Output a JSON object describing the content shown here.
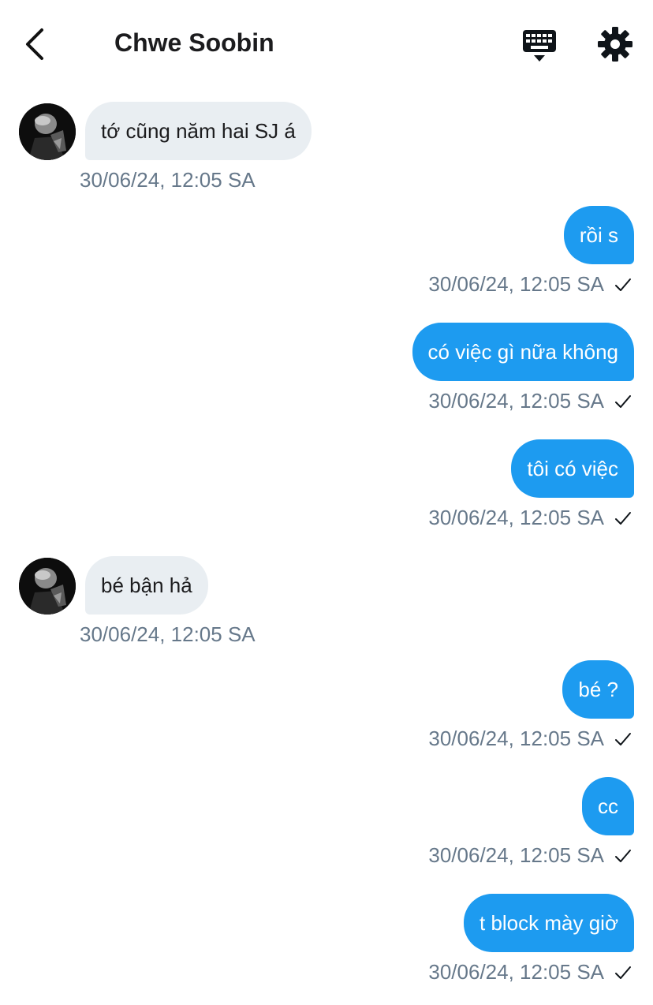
{
  "header": {
    "title": "Chwe Soobin",
    "back_icon": "chevron-left-icon",
    "keyboard_icon": "keyboard-icon",
    "settings_icon": "gear-icon"
  },
  "colors": {
    "outgoing_bubble": "#1d9bf0",
    "incoming_bubble": "#e9eef2",
    "timestamp": "#66788a"
  },
  "messages": [
    {
      "direction": "in",
      "text": "tớ cũng năm hai SJ á",
      "time": "30/06/24, 12:05 SA"
    },
    {
      "direction": "out",
      "text": "rồi s",
      "time": "30/06/24, 12:05 SA",
      "status": "sent-check-icon"
    },
    {
      "direction": "out",
      "text": "có việc gì nữa không",
      "time": "30/06/24, 12:05 SA",
      "status": "sent-check-icon"
    },
    {
      "direction": "out",
      "text": "tôi có việc",
      "time": "30/06/24, 12:05 SA",
      "status": "sent-check-icon"
    },
    {
      "direction": "in",
      "text": "bé bận hả",
      "time": "30/06/24, 12:05 SA"
    },
    {
      "direction": "out",
      "text": "bé ?",
      "time": "30/06/24, 12:05 SA",
      "status": "sent-check-icon"
    },
    {
      "direction": "out",
      "text": "cc",
      "time": "30/06/24, 12:05 SA",
      "status": "sent-check-icon"
    },
    {
      "direction": "out",
      "text": "t block mày giờ",
      "time": "30/06/24, 12:05 SA",
      "status": "sent-check-icon"
    }
  ]
}
